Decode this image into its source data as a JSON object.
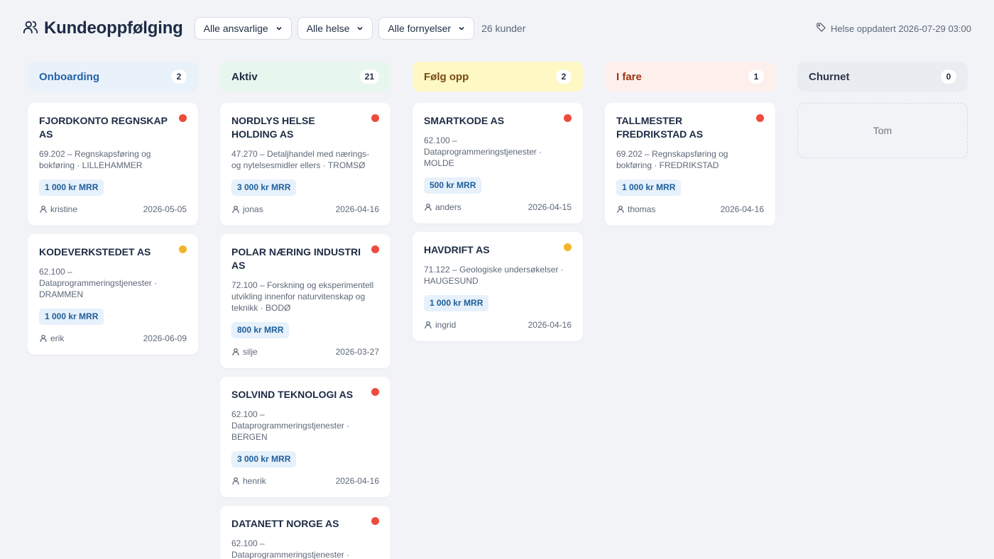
{
  "header": {
    "title": "Kundeoppfølging",
    "filters": [
      "Alle ansvarlige",
      "Alle helse",
      "Alle fornyelser"
    ],
    "count": "26 kunder",
    "health_updated": "Helse oppdatert 2026-07-29 03:00"
  },
  "columns": [
    {
      "title": "Onboarding",
      "count": "2",
      "bg": "#e9f1fb",
      "color": "#2563a5",
      "cards": [
        {
          "name": "FJORDKONTO REGNSKAP AS",
          "desc": "69.202 – Regnskapsføring og bokføring · LILLEHAMMER",
          "mrr": "1 000 kr MRR",
          "owner": "kristine",
          "date": "2026-05-05",
          "health": "red"
        },
        {
          "name": "KODEVERKSTEDET AS",
          "desc": "62.100 – Dataprogrammeringstjenester · DRAMMEN",
          "mrr": "1 000 kr MRR",
          "owner": "erik",
          "date": "2026-06-09",
          "health": "yellow"
        }
      ]
    },
    {
      "title": "Aktiv",
      "count": "21",
      "bg": "#e8f7ee",
      "color": "#1f2d44",
      "cards": [
        {
          "name": "NORDLYS HELSE HOLDING AS",
          "desc": "47.270 – Detaljhandel med nærings- og nytelsesmidler ellers · TROMSØ",
          "mrr": "3 000 kr MRR",
          "owner": "jonas",
          "date": "2026-04-16",
          "health": "red"
        },
        {
          "name": "POLAR NÆRING INDUSTRI AS",
          "desc": "72.100 – Forskning og eksperimentell utvikling innenfor naturvitenskap og teknikk · BODØ",
          "mrr": "800 kr MRR",
          "owner": "silje",
          "date": "2026-03-27",
          "health": "red"
        },
        {
          "name": "SOLVIND TEKNOLOGI AS",
          "desc": "62.100 – Dataprogrammeringstjenester · BERGEN",
          "mrr": "3 000 kr MRR",
          "owner": "henrik",
          "date": "2026-04-16",
          "health": "red"
        },
        {
          "name": "DATANETT NORGE AS",
          "desc": "62.100 – Dataprogrammeringstjenester ·",
          "mrr": "",
          "owner": "",
          "date": "",
          "health": "red"
        }
      ]
    },
    {
      "title": "Følg opp",
      "count": "2",
      "bg": "#fdf8c4",
      "color": "#7a4a12",
      "cards": [
        {
          "name": "SMARTKODE AS",
          "desc": "62.100 – Dataprogrammeringstjenester · MOLDE",
          "mrr": "500 kr MRR",
          "owner": "anders",
          "date": "2026-04-15",
          "health": "red"
        },
        {
          "name": "HAVDRIFT AS",
          "desc": "71.122 – Geologiske undersøkelser · HAUGESUND",
          "mrr": "1 000 kr MRR",
          "owner": "ingrid",
          "date": "2026-04-16",
          "health": "yellow"
        }
      ]
    },
    {
      "title": "I fare",
      "count": "1",
      "bg": "#fdf0ec",
      "color": "#9c3412",
      "cards": [
        {
          "name": "TALLMESTER FREDRIKSTAD AS",
          "desc": "69.202 – Regnskapsføring og bokføring · FREDRIKSTAD",
          "mrr": "1 000 kr MRR",
          "owner": "thomas",
          "date": "2026-04-16",
          "health": "red"
        }
      ]
    },
    {
      "title": "Churnet",
      "count": "0",
      "bg": "#e9ecf1",
      "color": "#2d3748",
      "empty_label": "Tom",
      "cards": []
    }
  ],
  "colors": {
    "red": "#ef4a3c",
    "yellow": "#f4b42a"
  },
  "icons": {
    "title": "users-icon",
    "filter": "chevron-down-icon",
    "health": "tag-icon",
    "owner": "user-icon"
  }
}
